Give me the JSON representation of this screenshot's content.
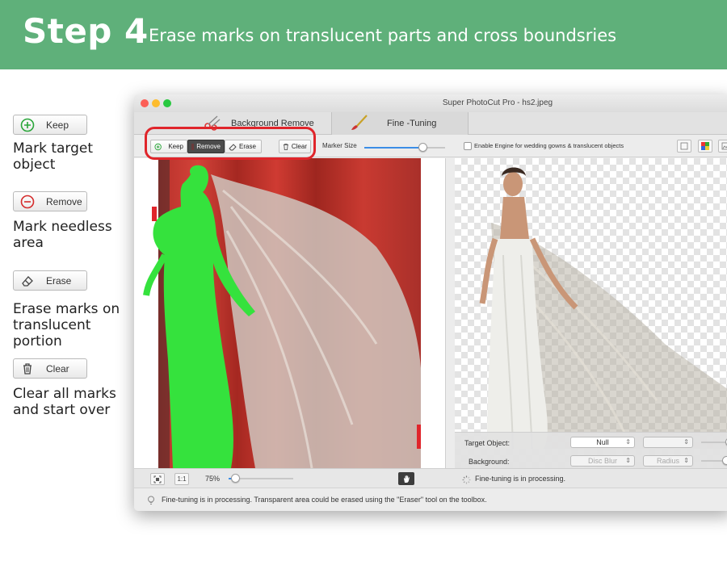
{
  "banner": {
    "step": "Step 4",
    "subtitle": "Erase marks on translucent parts and cross boundsries"
  },
  "legend": [
    {
      "label": "Keep",
      "icon": "plus-circle-icon",
      "desc": "Mark target object"
    },
    {
      "label": "Remove",
      "icon": "minus-circle-icon",
      "desc": "Mark needless area"
    },
    {
      "label": "Erase",
      "icon": "eraser-icon",
      "desc": "Erase marks on translucent portion"
    },
    {
      "label": "Clear",
      "icon": "trash-icon",
      "desc": "Clear all marks and start over"
    }
  ],
  "window": {
    "title": "Super PhotoCut Pro - hs2.jpeg",
    "tabs": [
      {
        "label": "Background Remove",
        "active": false
      },
      {
        "label": "Fine -Tuning",
        "active": true
      }
    ],
    "toolbar": {
      "keep": "Keep",
      "remove": "Remove",
      "erase": "Erase",
      "clear": "Clear",
      "marker_size_label": "Marker Size",
      "marker_size_value": 0.72,
      "engine_checkbox": "Enable Engine for wedding gowns & translucent objects",
      "engine_checked": false
    },
    "props": {
      "target_label": "Target Object:",
      "target_value": "Null",
      "background_label": "Background:",
      "background_value": "Disc Blur",
      "radius_value": "Radius"
    },
    "bottom": {
      "fit_icon": "fit-screen-icon",
      "one_to_one": "1:1",
      "zoom": "75%",
      "zoom_value": 0.1,
      "hand_icon": "hand-icon",
      "processing": "Fine-tuning is in processing."
    },
    "status": "Fine-tuning is in processing. Transparent area could be erased using the \"Eraser\" tool on the toolbox."
  },
  "colors": {
    "banner": "#5fb07a",
    "keep_mark": "#35e23d",
    "remove_mark": "#e0252b",
    "highlight_ring": "#e0252b"
  }
}
